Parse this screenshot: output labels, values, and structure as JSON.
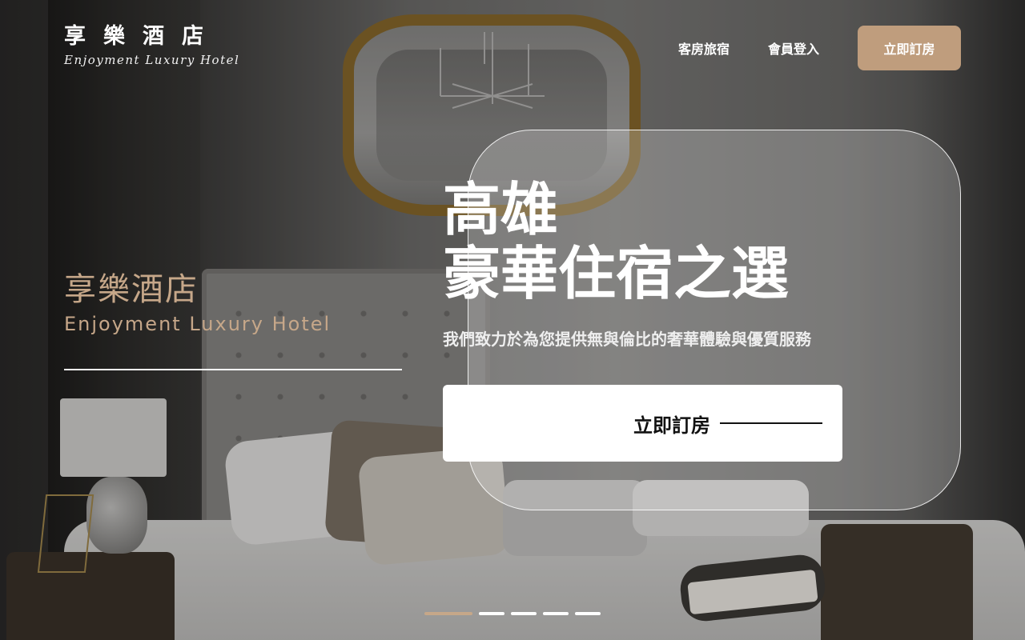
{
  "brand": {
    "name_zh": "享樂酒店",
    "name_en": "Enjoyment Luxury Hotel"
  },
  "nav": {
    "rooms_label": "客房旅宿",
    "login_label": "會員登入",
    "book_label": "立即訂房"
  },
  "hero": {
    "side_name_zh": "享樂酒店",
    "side_name_en": "Enjoyment Luxury Hotel",
    "title_line1": "高雄",
    "title_line2": "豪華住宿之選",
    "subtitle": "我們致力於為您提供無與倫比的奢華體驗與優質服務",
    "cta_label": "立即訂房"
  },
  "carousel": {
    "slide_count": 5,
    "active_index": 0
  },
  "colors": {
    "accent": "#BF9D7D",
    "white": "#FFFFFF"
  }
}
